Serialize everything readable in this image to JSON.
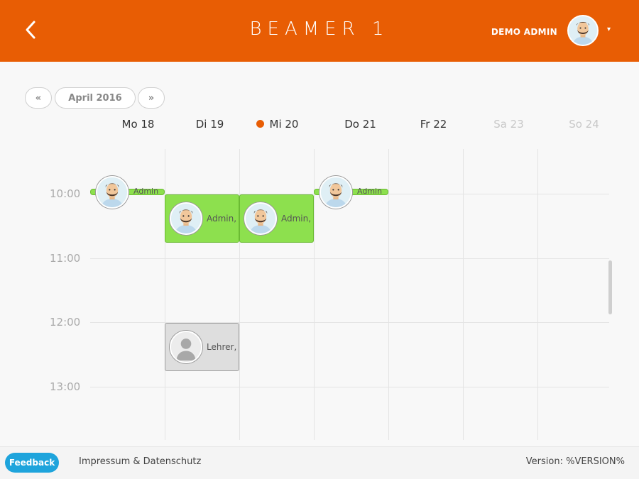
{
  "header": {
    "title": "BEAMER 1",
    "user_name": "DEMO ADMIN",
    "back_icon": "chevron-left-icon",
    "caret_icon": "chevron-down-icon",
    "accent_color": "#e85d04"
  },
  "navigation": {
    "prev_label": "«",
    "month_label": "April 2016",
    "next_label": "»"
  },
  "days": [
    {
      "label": "Mo 18",
      "today": false,
      "weekend": false
    },
    {
      "label": "Di 19",
      "today": false,
      "weekend": false
    },
    {
      "label": "Mi 20",
      "today": true,
      "weekend": false
    },
    {
      "label": "Do 21",
      "today": false,
      "weekend": false
    },
    {
      "label": "Fr 22",
      "today": false,
      "weekend": false
    },
    {
      "label": "Sa 23",
      "today": false,
      "weekend": true
    },
    {
      "label": "So 24",
      "today": false,
      "weekend": true
    }
  ],
  "times": [
    "10:00",
    "11:00",
    "12:00",
    "13:00"
  ],
  "events": [
    {
      "day": "Mo 18",
      "label": "Admin",
      "type": "thin",
      "color": "#8de04e"
    },
    {
      "day": "Di 19",
      "label": "Admin,",
      "type": "block",
      "color": "#8de04e"
    },
    {
      "day": "Mi 20",
      "label": "Admin,",
      "type": "block",
      "color": "#8de04e"
    },
    {
      "day": "Do 21",
      "label": "Admin",
      "type": "thin",
      "color": "#8de04e"
    },
    {
      "day": "Di 19",
      "label": "Lehrer,",
      "type": "block",
      "color": "#dedede"
    }
  ],
  "footer": {
    "feedback_label": "Feedback",
    "impressum_label": "Impressum & Datenschutz",
    "version_label": "Version: %VERSION%",
    "feedback_color": "#1ea4dc"
  }
}
